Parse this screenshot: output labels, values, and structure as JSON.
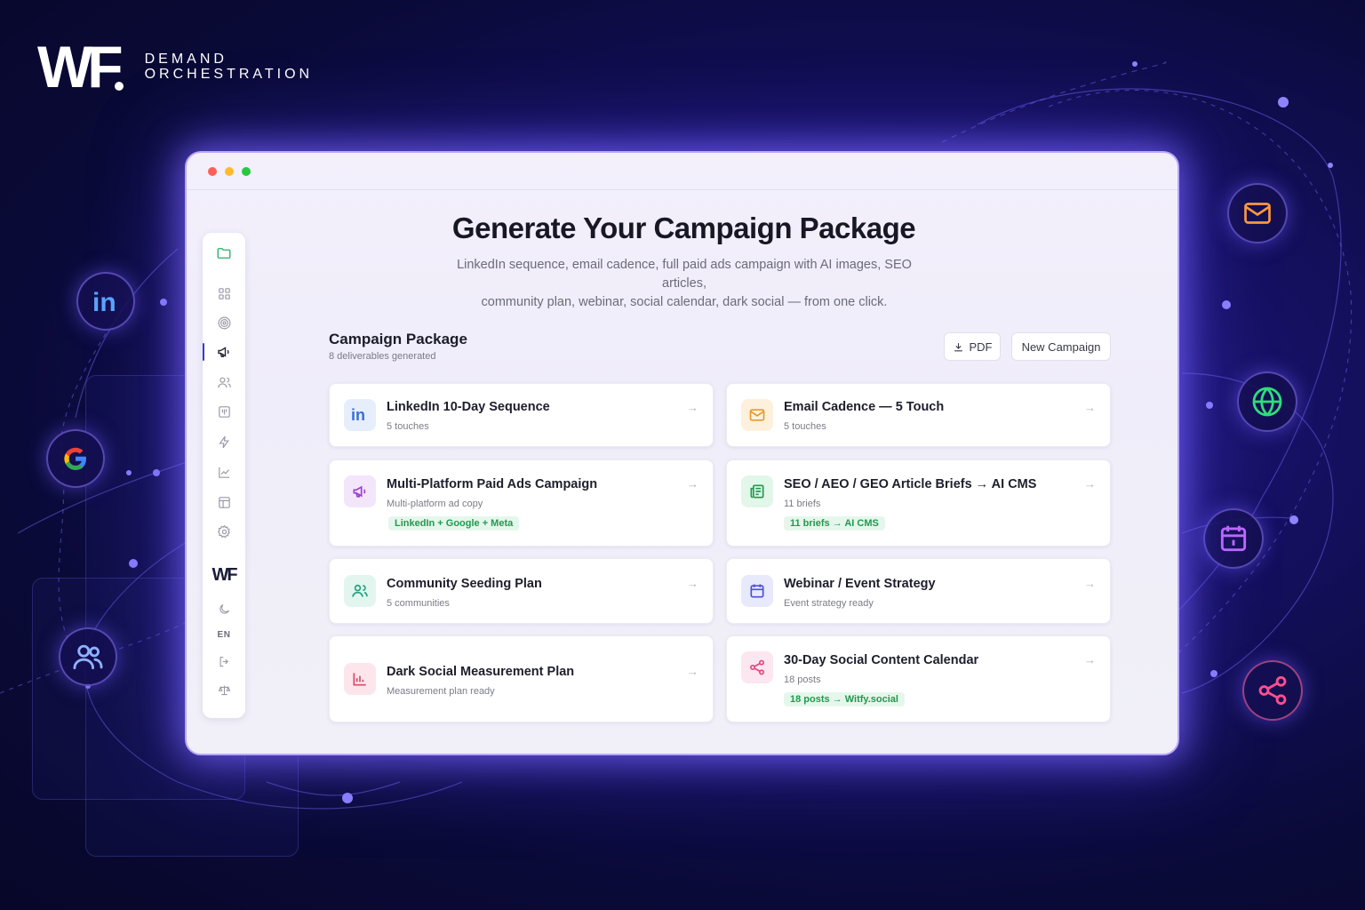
{
  "brand": {
    "logo": "WF",
    "line1": "DEMAND",
    "line2": "ORCHESTRATION"
  },
  "floating_icons": [
    "linkedin-icon",
    "google-icon",
    "users-icon",
    "mail-icon",
    "globe-icon",
    "calendar-icon",
    "share-icon"
  ],
  "window": {
    "sidebar": {
      "items": [
        "folder-icon",
        "grid-icon",
        "target-icon",
        "megaphone-icon",
        "users-icon",
        "board-icon",
        "bolt-icon",
        "chart-icon",
        "layout-icon",
        "settings-icon"
      ],
      "active_index": 3,
      "logo": "WF",
      "bottom": {
        "theme": "moon-icon",
        "language": "EN",
        "logout": "logout-icon",
        "legal": "scale-icon"
      }
    },
    "hero": {
      "title": "Generate Your Campaign Package",
      "subtitle_line1": "LinkedIn sequence, email cadence, full paid ads campaign with AI images, SEO articles,",
      "subtitle_line2": "community plan, webinar, social calendar, dark social — from one click."
    },
    "package": {
      "title": "Campaign Package",
      "subtitle": "8 deliverables generated",
      "pdf_label": "PDF",
      "new_campaign_label": "New Campaign"
    },
    "cards": [
      {
        "title": "LinkedIn 10-Day Sequence",
        "meta": "5 touches",
        "tag": "",
        "icon": "linkedin-icon",
        "color": "#3a6fd8",
        "bg": "#e6eefc"
      },
      {
        "title": "Email Cadence — 5 Touch",
        "meta": "5 touches",
        "tag": "",
        "icon": "mail-icon",
        "color": "#e59a2b",
        "bg": "#fdf1de"
      },
      {
        "title": "Multi-Platform Paid Ads Campaign",
        "meta": "Multi-platform ad copy",
        "tag": "LinkedIn + Google + Meta",
        "icon": "megaphone-icon",
        "color": "#9b3bd8",
        "bg": "#f3e6fb"
      },
      {
        "title": "SEO / AEO / GEO Article Briefs → AI CMS",
        "meta": "11 briefs",
        "tag": "11 briefs → AI CMS",
        "icon": "newspaper-icon",
        "color": "#1f9a4e",
        "bg": "#e3f6ea"
      },
      {
        "title": "Community Seeding Plan",
        "meta": "5 communities",
        "tag": "",
        "icon": "users-icon",
        "color": "#1fa37a",
        "bg": "#e2f6ef"
      },
      {
        "title": "Webinar / Event Strategy",
        "meta": "Event strategy ready",
        "tag": "",
        "icon": "calendar-icon",
        "color": "#4b4fd8",
        "bg": "#e8e9fb"
      },
      {
        "title": "Dark Social Measurement Plan",
        "meta": "Measurement plan ready",
        "tag": "",
        "icon": "bar-chart-icon",
        "color": "#e0476a",
        "bg": "#fce6ec"
      },
      {
        "title": "30-Day Social Content Calendar",
        "meta": "18 posts",
        "tag": "18 posts → Witfy.social",
        "icon": "share-icon",
        "color": "#e0477e",
        "bg": "#fce6ef"
      }
    ]
  }
}
